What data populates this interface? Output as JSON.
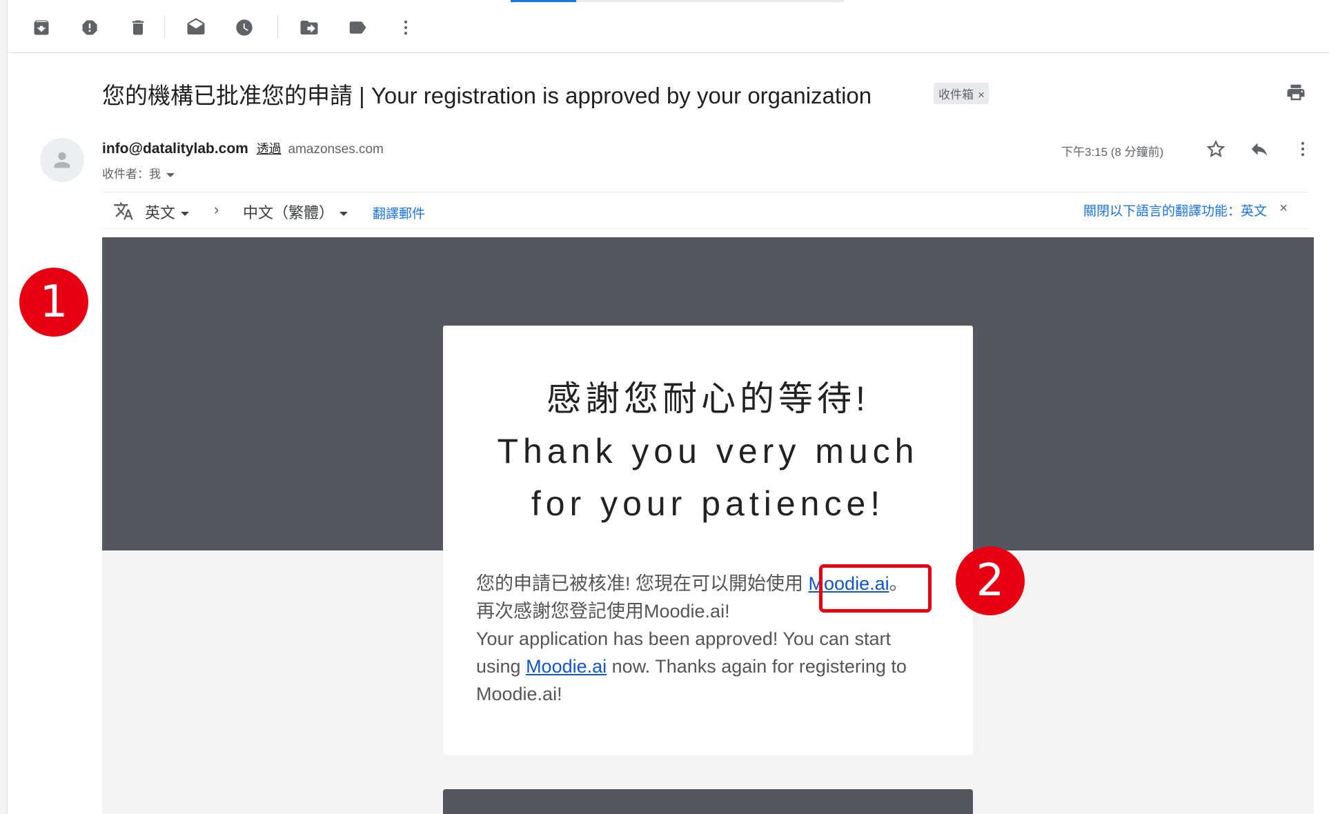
{
  "toolbar": {
    "buttons": [
      "archive-icon",
      "report-spam-icon",
      "delete-icon",
      "mark-unread-icon",
      "snooze-icon",
      "move-to-icon",
      "labels-icon",
      "more-vert-icon"
    ]
  },
  "email": {
    "subject": "您的機構已批准您的申請 | Your registration is approved by your organization",
    "label": "收件箱",
    "label_remove": "×",
    "sender_email": "info@datalitylab.com",
    "sender_via": "透過",
    "sender_domain": "amazonses.com",
    "recipient_label": "收件者：我",
    "timestamp": "下午3:15 (8 分鐘前)"
  },
  "translate": {
    "source_lang": "英文",
    "arrow": "›",
    "target_lang": "中文（繁體）",
    "translate_link": "翻譯郵件",
    "turn_off": "關閉以下語言的翻譯功能：英文",
    "close": "×"
  },
  "body": {
    "heading_zh": "感謝您耐心的等待!",
    "heading_en1": "Thank you very much",
    "heading_en2": "for your patience!",
    "zh_line1_pre": "您的申請已被核准! 您現在可以開始使用",
    "zh_link": "Moodie.ai",
    "zh_line1_post": "。",
    "zh_line2": "再次感謝您登記使用Moodie.ai!",
    "en_pre": "Your application has been approved! You can start using",
    "en_link": "Moodie.ai",
    "en_post": "now. Thanks again for registering to Moodie.ai!"
  },
  "annotations": {
    "badge1": "1",
    "badge2": "2"
  },
  "colors": {
    "band": "#53575f",
    "link": "#1155cc",
    "annotation": "#e60012"
  }
}
